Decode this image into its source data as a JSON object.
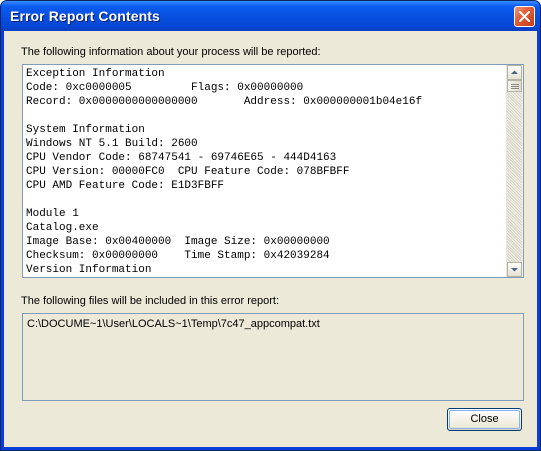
{
  "window": {
    "title": "Error Report Contents"
  },
  "report": {
    "label": "The following information about your process will be reported:",
    "lines": [
      "Exception Information",
      "Code: 0xc0000005         Flags: 0x00000000",
      "Record: 0x0000000000000000       Address: 0x000000001b04e16f",
      "",
      "System Information",
      "Windows NT 5.1 Build: 2600",
      "CPU Vendor Code: 68747541 - 69746E65 - 444D4163",
      "CPU Version: 00000FC0  CPU Feature Code: 078BFBFF",
      "CPU AMD Feature Code: E1D3FBFF",
      "",
      "Module 1",
      "Catalog.exe",
      "Image Base: 0x00400000  Image Size: 0x00000000",
      "Checksum: 0x00000000    Time Stamp: 0x42039284",
      "Version Information"
    ]
  },
  "files": {
    "label": "The following files will be included in this error report:",
    "items": [
      "C:\\DOCUME~1\\User\\LOCALS~1\\Temp\\7c47_appcompat.txt"
    ]
  },
  "buttons": {
    "close_label": "Close"
  },
  "colors": {
    "titlebar": "#0850e0",
    "dialog_bg": "#ece9d8",
    "field_border": "#7f9db9",
    "close_button": "#e05a33"
  },
  "icons": {
    "title_close": "close-x-icon",
    "scroll_up": "arrow-up-icon",
    "scroll_down": "arrow-down-icon"
  }
}
